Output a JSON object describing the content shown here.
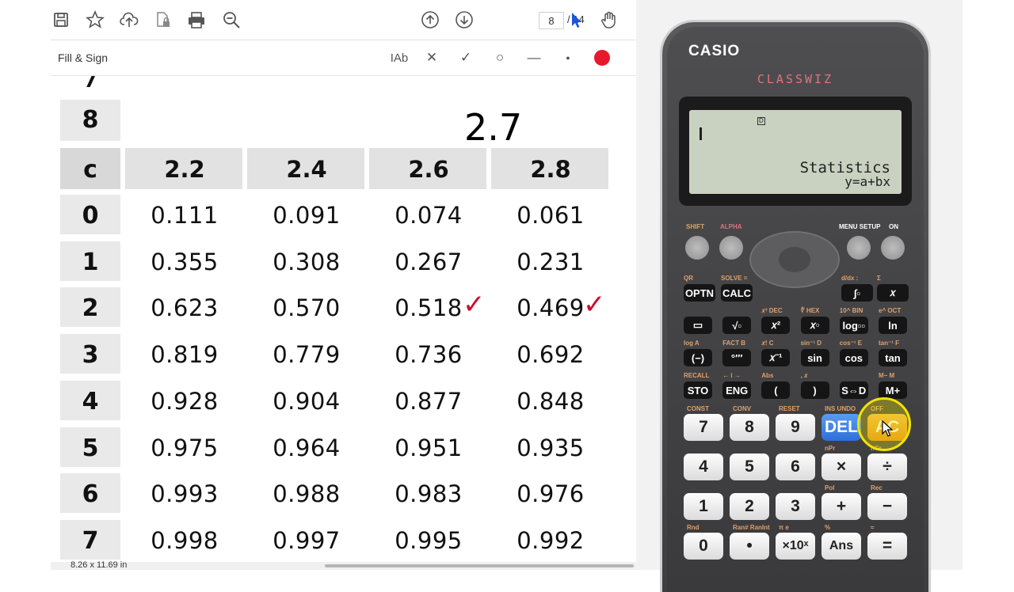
{
  "toolbar": {
    "icons": [
      "save-icon",
      "star-icon",
      "upload-icon",
      "file-lock-icon",
      "print-icon",
      "zoom-out-icon",
      "page-up-icon",
      "page-down-icon",
      "pointer-icon",
      "hand-icon"
    ],
    "page_current": "8",
    "page_total": "/ 14"
  },
  "fill_sign": {
    "label": "Fill & Sign",
    "tools": {
      "text": "IAb",
      "cross": "✕",
      "check": "✓",
      "ellipse": "○",
      "line": "—",
      "dot": "●"
    },
    "color": "#e8192c"
  },
  "table": {
    "partial_top_row": "7",
    "header_row_label": "8",
    "written_value": "2.7",
    "key_label": "c",
    "columns": [
      "2.2",
      "2.4",
      "2.6",
      "2.8"
    ],
    "rows": [
      {
        "label": "0",
        "values": [
          "0.111",
          "0.091",
          "0.074",
          "0.061"
        ]
      },
      {
        "label": "1",
        "values": [
          "0.355",
          "0.308",
          "0.267",
          "0.231"
        ]
      },
      {
        "label": "2",
        "values": [
          "0.623",
          "0.570",
          "0.518",
          "0.469"
        ]
      },
      {
        "label": "3",
        "values": [
          "0.819",
          "0.779",
          "0.736",
          "0.692"
        ]
      },
      {
        "label": "4",
        "values": [
          "0.928",
          "0.904",
          "0.877",
          "0.848"
        ]
      },
      {
        "label": "5",
        "values": [
          "0.975",
          "0.964",
          "0.951",
          "0.935"
        ]
      },
      {
        "label": "6",
        "values": [
          "0.993",
          "0.988",
          "0.983",
          "0.976"
        ]
      },
      {
        "label": "7",
        "values": [
          "0.998",
          "0.997",
          "0.995",
          "0.992"
        ]
      }
    ],
    "tick_marks": [
      "✓",
      "✓"
    ]
  },
  "status": {
    "dimensions": "8.26 x 11.69 in"
  },
  "calculator": {
    "brand": "CASIO",
    "model": "CLASSWIZ",
    "display_indicator": "D",
    "display_line1": "Statistics",
    "display_line2": "y=a+bx",
    "top_labels": {
      "shift": "SHIFT",
      "alpha": "ALPHA",
      "menu": "MENU SETUP",
      "on": "ON"
    },
    "fn_rows": [
      [
        "OPTN",
        "CALC",
        "∫▫",
        "𝑥"
      ],
      [
        "▭",
        "√▫",
        "𝑥²",
        "𝑥▫",
        "log▫▫",
        "ln"
      ],
      [
        "(−)",
        "°′″",
        "𝑥⁻¹",
        "sin",
        "cos",
        "tan"
      ],
      [
        "STO",
        "ENG",
        "(",
        ")",
        "S⇔D",
        "M+"
      ]
    ],
    "fn_sublabels": [
      [
        "QR",
        "SOLVE =",
        "d/dx :",
        "Σ"
      ],
      [
        "",
        "",
        "𝑥³ DEC",
        "∜ HEX",
        "10^ BIN",
        "e^ OCT"
      ],
      [
        "log A",
        "FACT B",
        "𝑥! C",
        "sin⁻¹ D",
        "cos⁻¹ E",
        "tan⁻¹ F"
      ],
      [
        "RECALL",
        "← i →",
        "Abs",
        ", 𝑥",
        "",
        "M− M"
      ]
    ],
    "keys": [
      [
        "7",
        "8",
        "9",
        "DEL",
        "AC"
      ],
      [
        "4",
        "5",
        "6",
        "×",
        "÷"
      ],
      [
        "1",
        "2",
        "3",
        "+",
        "−"
      ],
      [
        "0",
        "•",
        "×10ˣ",
        "Ans",
        "="
      ]
    ],
    "key_labels": [
      [
        "CONST",
        "CONV",
        "RESET",
        "INS UNDO",
        "OFF"
      ],
      [
        "",
        "",
        "",
        "nPr",
        "nCr"
      ],
      [
        "",
        "",
        "",
        "Pol",
        "Rec"
      ],
      [
        "Rnd",
        "Ran# RanInt",
        "π e",
        "%",
        "≈"
      ]
    ]
  }
}
